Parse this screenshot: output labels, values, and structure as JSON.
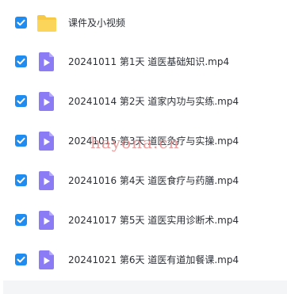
{
  "files": [
    {
      "name": "课件及小视频",
      "type": "folder",
      "checked": true
    },
    {
      "name": "20241011 第1天 道医基础知识.mp4",
      "type": "video",
      "checked": true
    },
    {
      "name": "20241014 第2天 道家内功与实练.mp4",
      "type": "video",
      "checked": true
    },
    {
      "name": "20241015 第3天 道医灸疗与实操.mp4",
      "type": "video",
      "checked": true
    },
    {
      "name": "20241016 第4天 道医食疗与药膳.mp4",
      "type": "video",
      "checked": true
    },
    {
      "name": "20241017 第5天 道医实用诊断术.mp4",
      "type": "video",
      "checked": true
    },
    {
      "name": "20241021 第6天 道医有道加餐课.mp4",
      "type": "video",
      "checked": true
    }
  ],
  "watermark": "hayona.cn",
  "colors": {
    "checkbox": "#1e8cf0",
    "folder": "#f7c948",
    "video": "#8b7cf6",
    "text": "#2b2f36"
  }
}
